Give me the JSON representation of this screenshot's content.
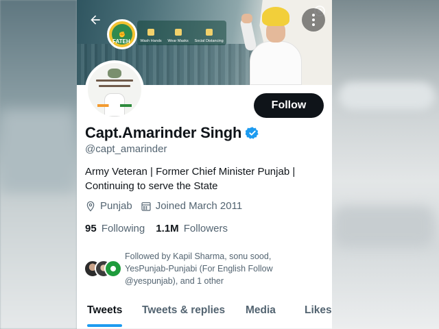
{
  "profile": {
    "display_name": "Capt.Amarinder Singh",
    "handle": "@capt_amarinder",
    "verified": true,
    "bio_lines": [
      "Army Veteran | Former Chief Minister Punjab |",
      "Continuing to serve the State"
    ],
    "location": "Punjab",
    "joined": "Joined March 2011",
    "following_count": "95",
    "following_label": "Following",
    "followers_count": "1.1M",
    "followers_label": "Followers"
  },
  "banner": {
    "logo_text": "FATEH",
    "covid_items": [
      "Wash Hands",
      "Wear Masks",
      "Social Distancing"
    ]
  },
  "actions": {
    "follow_label": "Follow"
  },
  "followed_by": {
    "lines": [
      "Followed by Kapil Sharma, sonu sood,",
      "YesPunjab-Punjabi (For English Follow",
      "@yespunjab), and 1 other"
    ]
  },
  "tabs": [
    {
      "label": "Tweets",
      "active": true
    },
    {
      "label": "Tweets & replies",
      "active": false
    },
    {
      "label": "Media",
      "active": false
    },
    {
      "label": "Likes",
      "active": false
    }
  ],
  "colors": {
    "accent": "#1d9bf0",
    "text_primary": "#0f1419",
    "text_secondary": "#536471",
    "follow_button": "#0f1419",
    "logo_yellow": "#f2c230"
  },
  "icons": {
    "back": "arrow-left-icon",
    "more": "more-vertical-icon",
    "verified": "verified-badge-icon",
    "location": "location-pin-icon",
    "calendar": "calendar-icon"
  }
}
